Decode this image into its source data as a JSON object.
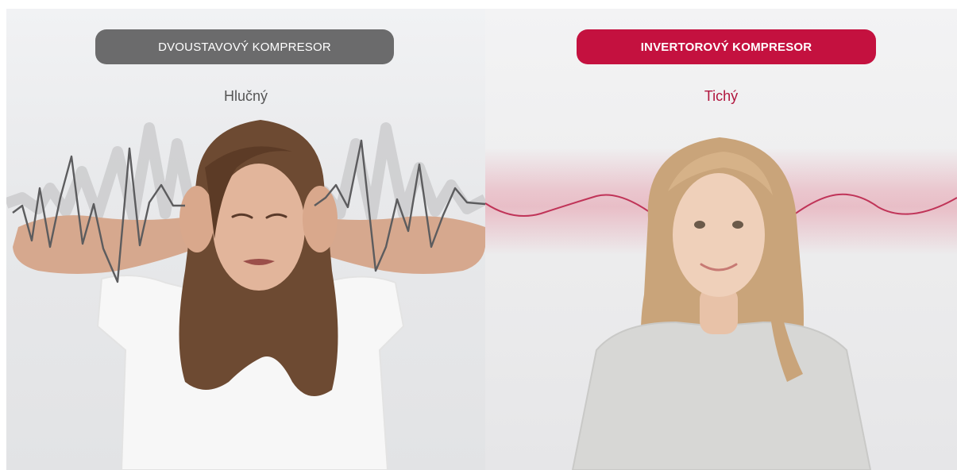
{
  "left_panel": {
    "badge_label": "DVOUSTAVOVÝ KOMPRESOR",
    "subtitle": "Hlučný",
    "accent_color": "#6b6b6c"
  },
  "right_panel": {
    "badge_label": "INVERTOROVÝ KOMPRESOR",
    "subtitle": "Tichý",
    "accent_color": "#c4113f"
  }
}
